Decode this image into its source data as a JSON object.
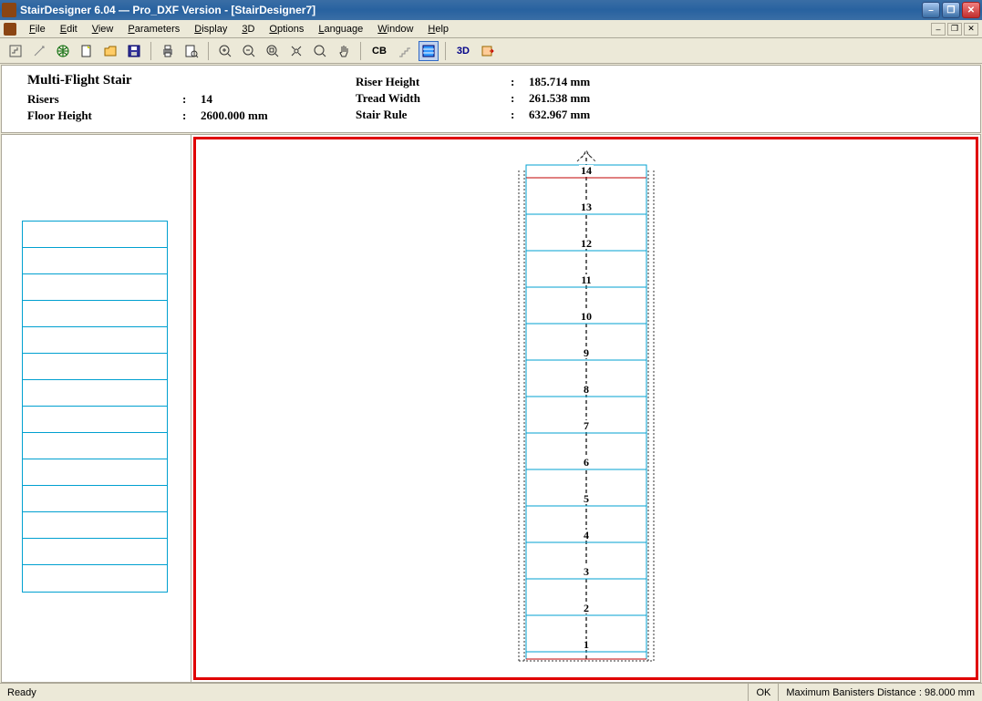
{
  "window": {
    "title": "StairDesigner 6.04 — Pro_DXF Version - [StairDesigner7]"
  },
  "menu": {
    "file": "File",
    "edit": "Edit",
    "view": "View",
    "parameters": "Parameters",
    "display": "Display",
    "three_d": "3D",
    "options": "Options",
    "language": "Language",
    "window": "Window",
    "help": "Help"
  },
  "toolbar": {
    "cb_label": "CB",
    "three_d_label": "3D"
  },
  "info": {
    "title": "Multi-Flight Stair",
    "risers_label": "Risers",
    "risers_value": "14",
    "floor_height_label": "Floor Height",
    "floor_height_value": "2600.000 mm",
    "riser_height_label": "Riser Height",
    "riser_height_value": "185.714 mm",
    "tread_width_label": "Tread Width",
    "tread_width_value": "261.538 mm",
    "stair_rule_label": "Stair Rule",
    "stair_rule_value": "632.967 mm"
  },
  "stair": {
    "steps": [
      "14",
      "13",
      "12",
      "11",
      "10",
      "9",
      "8",
      "7",
      "6",
      "5",
      "4",
      "3",
      "2",
      "1"
    ]
  },
  "status": {
    "ready": "Ready",
    "ok": "OK",
    "banisters": "Maximum Banisters Distance : 98.000 mm"
  }
}
